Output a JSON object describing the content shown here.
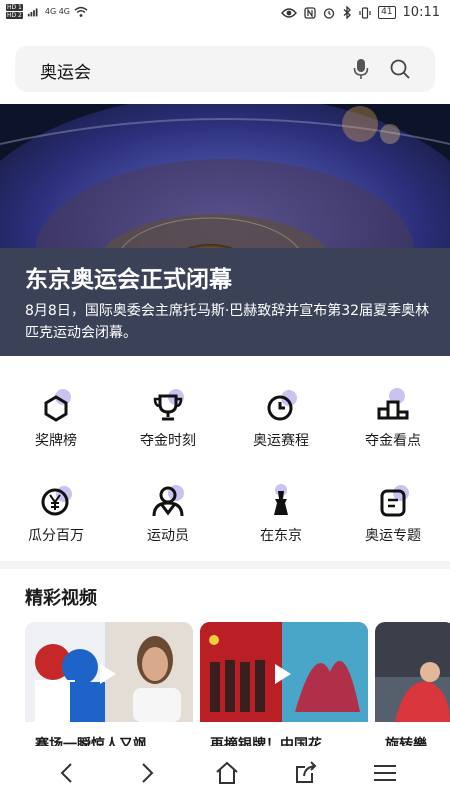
{
  "status_bar": {
    "left_badges": [
      "HD 1",
      "HD 2"
    ],
    "signal_text": "4G 4G",
    "battery": "41",
    "time": "10:11"
  },
  "search": {
    "query": "奥运会",
    "icons": [
      "microphone-icon",
      "search-icon"
    ]
  },
  "hero": {
    "title": "东京奥运会正式闭幕",
    "description": "8月8日，国际奥委会主席托马斯·巴赫致辞并宣布第32届夏季奥林匹克运动会闭幕。"
  },
  "grid": [
    {
      "label": "奖牌榜",
      "icon": "medal-icon"
    },
    {
      "label": "夺金时刻",
      "icon": "trophy-icon"
    },
    {
      "label": "奥运赛程",
      "icon": "clock-icon"
    },
    {
      "label": "夺金看点",
      "icon": "podium-icon"
    },
    {
      "label": "瓜分百万",
      "icon": "yen-coin-icon"
    },
    {
      "label": "运动员",
      "icon": "athlete-icon"
    },
    {
      "label": "在东京",
      "icon": "tower-icon"
    },
    {
      "label": "奥运专题",
      "icon": "topic-icon"
    }
  ],
  "videos": {
    "section_title": "精彩视频",
    "items": [
      {
        "title": "赛场一瞬惊人又飒"
      },
      {
        "title": "再摘银牌！中国花"
      },
      {
        "title": "旋转樂"
      }
    ]
  },
  "colors": {
    "accent_blob": "#c8c3f0",
    "hero_panel": "#3b4258",
    "search_bg": "#f4f4f4"
  }
}
